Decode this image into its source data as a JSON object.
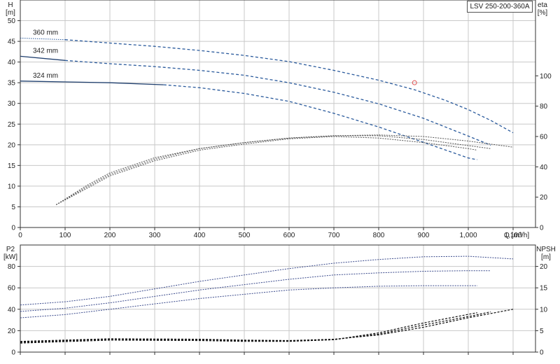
{
  "model_label": "LSV 250-200-360A",
  "colors": {
    "grid": "#c8c8c8",
    "frame": "#333333",
    "head": "#1f3f6e",
    "head_dash": "#2a5a9c",
    "eff": "#555555",
    "power": "#3a4a8c",
    "npsh": "#111111",
    "duty_point": "#e05050"
  },
  "chart_data": [
    {
      "type": "line",
      "name": "head-efficiency",
      "xlabel": "Q [m³/h]",
      "ylabel": "H [m]",
      "y2label": "eta [%]",
      "xlim": [
        0,
        1150
      ],
      "ylim": [
        0,
        55
      ],
      "y2lim": [
        0,
        150
      ],
      "x_ticks": [
        0,
        100,
        200,
        300,
        400,
        500,
        600,
        700,
        800,
        900,
        1000,
        1100
      ],
      "x_tick_labels": [
        "0",
        "100",
        "200",
        "300",
        "400",
        "500",
        "600",
        "700",
        "800",
        "900",
        "1,000",
        "1,100"
      ],
      "y_ticks": [
        0,
        5,
        10,
        15,
        20,
        25,
        30,
        35,
        40,
        45,
        50
      ],
      "y2_ticks": [
        0,
        20,
        40,
        60,
        80,
        100
      ],
      "grid": true,
      "series": [
        {
          "name": "360 mm",
          "kind": "head",
          "solid_until": 0,
          "x": [
            0,
            100,
            200,
            300,
            400,
            500,
            600,
            700,
            800,
            880,
            950,
            1000,
            1050,
            1100
          ],
          "y": [
            45.8,
            45.4,
            44.6,
            43.8,
            42.8,
            41.6,
            40.1,
            38.0,
            35.6,
            33.3,
            30.7,
            28.5,
            25.9,
            22.9
          ]
        },
        {
          "name": "342 mm",
          "kind": "head",
          "solid_until": 100,
          "x": [
            0,
            100,
            200,
            300,
            400,
            500,
            600,
            700,
            800,
            900,
            1000,
            1050
          ],
          "y": [
            41.4,
            40.4,
            39.6,
            38.9,
            38.0,
            36.8,
            35.0,
            32.7,
            29.9,
            26.4,
            22.1,
            19.9
          ]
        },
        {
          "name": "324 mm",
          "kind": "head",
          "solid_until": 320,
          "x": [
            0,
            100,
            200,
            320,
            400,
            500,
            600,
            700,
            800,
            900,
            1000,
            1020
          ],
          "y": [
            35.4,
            35.2,
            35.0,
            34.5,
            33.8,
            32.4,
            30.5,
            27.6,
            24.3,
            20.6,
            16.8,
            16.4
          ]
        },
        {
          "name": "",
          "kind": "eff",
          "x": [
            80,
            150,
            200,
            300,
            400,
            500,
            600,
            700,
            800,
            900,
            1000,
            1100
          ],
          "y": [
            15,
            28,
            36,
            46,
            52,
            56,
            59,
            60.5,
            61,
            60,
            57,
            53
          ]
        },
        {
          "name": "",
          "kind": "eff",
          "x": [
            80,
            150,
            200,
            300,
            400,
            500,
            600,
            700,
            800,
            900,
            1000,
            1050
          ],
          "y": [
            15,
            27,
            35,
            45,
            52,
            56,
            59,
            60.5,
            60.5,
            58,
            54,
            52
          ]
        },
        {
          "name": "",
          "kind": "eff",
          "x": [
            80,
            150,
            200,
            300,
            400,
            500,
            600,
            700,
            800,
            900,
            1000,
            1020
          ],
          "y": [
            15,
            26,
            34,
            44,
            51,
            55,
            58.5,
            60,
            59,
            56,
            52,
            51
          ]
        }
      ],
      "duty_point": {
        "x": 880,
        "y": 35
      }
    },
    {
      "type": "line",
      "name": "power-npsh",
      "xlabel": "",
      "ylabel": "P2 [kW]",
      "y2label": "NPSH [m]",
      "xlim": [
        0,
        1150
      ],
      "ylim": [
        0,
        100
      ],
      "y2lim": [
        0,
        25
      ],
      "y_ticks": [
        0,
        20,
        40,
        60,
        80
      ],
      "y2_ticks": [
        0,
        5,
        10,
        15,
        20
      ],
      "grid": true,
      "series": [
        {
          "name": "",
          "kind": "power",
          "x": [
            0,
            100,
            200,
            300,
            400,
            500,
            600,
            700,
            800,
            900,
            1000,
            1100
          ],
          "y": [
            44,
            47,
            52,
            59,
            66,
            72,
            78,
            83,
            86.5,
            89,
            89.5,
            87
          ]
        },
        {
          "name": "",
          "kind": "power",
          "x": [
            0,
            100,
            200,
            300,
            400,
            500,
            600,
            700,
            800,
            900,
            1000,
            1050
          ],
          "y": [
            38,
            41,
            46,
            52,
            58,
            63,
            68,
            72,
            74,
            75.5,
            76,
            76
          ]
        },
        {
          "name": "",
          "kind": "power",
          "x": [
            0,
            100,
            200,
            300,
            400,
            500,
            600,
            700,
            800,
            900,
            1000,
            1020
          ],
          "y": [
            32,
            35,
            40,
            45,
            50,
            54,
            58,
            60,
            61.5,
            62,
            62,
            62
          ]
        },
        {
          "name": "",
          "kind": "npsh",
          "x": [
            0,
            200,
            400,
            500,
            600,
            700,
            800,
            900,
            1000,
            1100
          ],
          "y": [
            2.5,
            3.1,
            3.0,
            2.8,
            2.7,
            3.0,
            4.0,
            5.8,
            8.0,
            10.0
          ]
        },
        {
          "name": "",
          "kind": "npsh",
          "x": [
            0,
            200,
            400,
            500,
            600,
            700,
            800,
            900,
            1000,
            1050
          ],
          "y": [
            2.3,
            3.0,
            2.9,
            2.7,
            2.6,
            2.9,
            4.2,
            6.3,
            8.3,
            9.4
          ]
        },
        {
          "name": "",
          "kind": "npsh",
          "x": [
            0,
            200,
            400,
            500,
            600,
            700,
            800,
            900,
            1000,
            1020
          ],
          "y": [
            2.1,
            2.8,
            2.7,
            2.5,
            2.5,
            2.9,
            4.5,
            6.8,
            8.8,
            9.2
          ]
        }
      ]
    }
  ]
}
